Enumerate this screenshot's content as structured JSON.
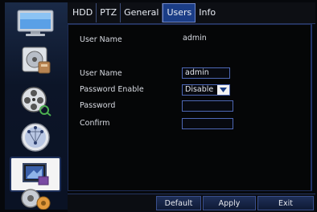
{
  "tabs": {
    "hdd": "HDD",
    "ptz": "PTZ",
    "general": "General",
    "users": "Users",
    "info": "Info"
  },
  "panel": {
    "current_user_label": "User Name",
    "current_user_value": "admin",
    "user_name_label": "User Name",
    "user_name_value": "admin",
    "password_enable_label": "Password Enable",
    "password_enable_value": "Disable",
    "password_label": "Password",
    "password_value": "",
    "confirm_label": "Confirm",
    "confirm_value": ""
  },
  "buttons": {
    "default": "Default",
    "apply": "Apply",
    "exit": "Exit"
  },
  "sidebar": {
    "items": [
      {
        "icon": "monitor-icon"
      },
      {
        "icon": "hdd-icon"
      },
      {
        "icon": "film-reel-icon"
      },
      {
        "icon": "network-icon"
      },
      {
        "icon": "system-settings-icon",
        "active": true
      },
      {
        "icon": "gears-icon"
      }
    ]
  },
  "colors": {
    "accent": "#1b3d86",
    "border": "#4d67b4"
  }
}
